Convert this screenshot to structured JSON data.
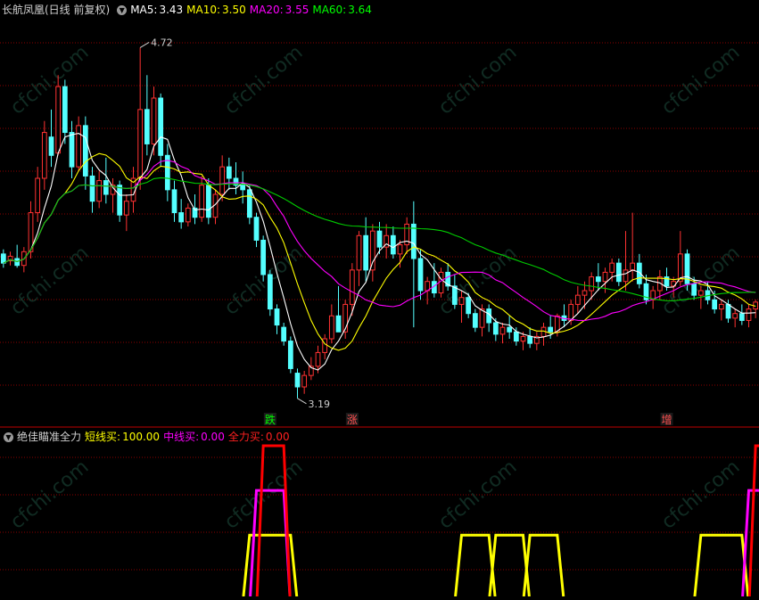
{
  "main": {
    "title": "长航凤凰(日线 前复权)",
    "ma5_label": "MA5:",
    "ma5_value": "3.43",
    "ma10_label": "MA10:",
    "ma10_value": "3.50",
    "ma20_label": "MA20:",
    "ma20_value": "3.55",
    "ma60_label": "MA60:",
    "ma60_value": "3.64",
    "high_mark": "4.72",
    "low_mark": "3.19",
    "signals": [
      "跌",
      "涨",
      "增"
    ]
  },
  "indicator": {
    "title": "绝佳瞄准全力",
    "short_label": "短线买:",
    "short_value": "100.00",
    "mid_label": "中线买:",
    "mid_value": "0.00",
    "full_label": "全力买:",
    "full_value": "0.00"
  },
  "colors": {
    "background": "#000000",
    "grid": "#8b0000",
    "up_candle": "#ff3232",
    "down_candle": "#54ffff",
    "ma5": "#ffffff",
    "ma10": "#ffff00",
    "ma20": "#ff00ff",
    "ma60": "#00cc00",
    "short_buy": "#ffff00",
    "mid_buy": "#ff00ff",
    "full_buy": "#ff0000",
    "watermark": "#1e4f3e"
  },
  "icons": [
    "circle-dropdown-icon"
  ],
  "watermark": "cfchi.com",
  "chart_data": [
    {
      "type": "candlestick",
      "title": "长航凤凰(日线 前复权)",
      "ylim": [
        3.1,
        4.85
      ],
      "annotations": {
        "high": 4.72,
        "low": 3.19
      },
      "signals": [
        {
          "text": "跌",
          "index": 39
        },
        {
          "text": "涨",
          "index": 51
        },
        {
          "text": "增",
          "index": 97
        }
      ],
      "candles": [
        [
          3.82,
          3.84,
          3.76,
          3.78
        ],
        [
          3.79,
          3.83,
          3.77,
          3.81
        ],
        [
          3.8,
          3.86,
          3.76,
          3.77
        ],
        [
          3.77,
          3.85,
          3.74,
          3.83
        ],
        [
          3.83,
          4.05,
          3.8,
          4.0
        ],
        [
          4.0,
          4.2,
          3.96,
          4.15
        ],
        [
          4.15,
          4.4,
          4.1,
          4.35
        ],
        [
          4.33,
          4.45,
          4.2,
          4.25
        ],
        [
          4.26,
          4.6,
          4.25,
          4.55
        ],
        [
          4.55,
          4.58,
          4.3,
          4.35
        ],
        [
          4.35,
          4.4,
          4.15,
          4.2
        ],
        [
          4.2,
          4.42,
          4.18,
          4.38
        ],
        [
          4.38,
          4.42,
          4.1,
          4.16
        ],
        [
          4.16,
          4.2,
          4.0,
          4.05
        ],
        [
          4.05,
          4.18,
          4.02,
          4.14
        ],
        [
          4.14,
          4.24,
          4.04,
          4.08
        ],
        [
          4.08,
          4.15,
          4.0,
          4.12
        ],
        [
          4.12,
          4.14,
          3.96,
          3.99
        ],
        [
          3.99,
          4.08,
          3.92,
          4.05
        ],
        [
          4.05,
          4.2,
          4.0,
          4.15
        ],
        [
          4.15,
          4.72,
          4.1,
          4.45
        ],
        [
          4.45,
          4.6,
          4.25,
          4.3
        ],
        [
          4.3,
          4.55,
          4.25,
          4.5
        ],
        [
          4.5,
          4.52,
          4.2,
          4.25
        ],
        [
          4.25,
          4.3,
          4.05,
          4.1
        ],
        [
          4.1,
          4.14,
          3.96,
          4.0
        ],
        [
          4.0,
          4.06,
          3.93,
          3.96
        ],
        [
          3.96,
          4.04,
          3.94,
          4.02
        ],
        [
          4.02,
          4.08,
          3.95,
          3.98
        ],
        [
          3.98,
          4.16,
          3.96,
          4.12
        ],
        [
          4.12,
          4.15,
          3.95,
          3.98
        ],
        [
          3.98,
          4.1,
          3.95,
          4.08
        ],
        [
          4.08,
          4.25,
          4.05,
          4.2
        ],
        [
          4.2,
          4.24,
          4.1,
          4.15
        ],
        [
          4.15,
          4.22,
          4.08,
          4.12
        ],
        [
          4.12,
          4.18,
          4.04,
          4.1
        ],
        [
          4.1,
          4.12,
          3.95,
          3.98
        ],
        [
          3.98,
          4.0,
          3.85,
          3.88
        ],
        [
          3.88,
          3.9,
          3.7,
          3.73
        ],
        [
          3.73,
          3.75,
          3.55,
          3.58
        ],
        [
          3.58,
          3.6,
          3.47,
          3.51
        ],
        [
          3.5,
          3.52,
          3.42,
          3.44
        ],
        [
          3.44,
          3.46,
          3.3,
          3.32
        ],
        [
          3.3,
          3.32,
          3.19,
          3.24
        ],
        [
          3.24,
          3.31,
          3.21,
          3.29
        ],
        [
          3.29,
          3.37,
          3.27,
          3.33
        ],
        [
          3.33,
          3.42,
          3.3,
          3.39
        ],
        [
          3.39,
          3.47,
          3.36,
          3.45
        ],
        [
          3.45,
          3.6,
          3.43,
          3.55
        ],
        [
          3.55,
          3.68,
          3.5,
          3.48
        ],
        [
          3.48,
          3.62,
          3.45,
          3.6
        ],
        [
          3.6,
          3.78,
          3.55,
          3.75
        ],
        [
          3.75,
          3.92,
          3.68,
          3.9
        ],
        [
          3.9,
          3.98,
          3.7,
          3.75
        ],
        [
          3.75,
          3.95,
          3.7,
          3.92
        ],
        [
          3.92,
          3.96,
          3.82,
          3.85
        ],
        [
          3.85,
          3.95,
          3.8,
          3.9
        ],
        [
          3.9,
          3.94,
          3.8,
          3.82
        ],
        [
          3.82,
          3.88,
          3.76,
          3.86
        ],
        [
          3.86,
          3.98,
          3.82,
          3.95
        ],
        [
          3.95,
          4.05,
          3.5,
          3.8
        ],
        [
          3.8,
          3.84,
          3.62,
          3.66
        ],
        [
          3.66,
          3.72,
          3.6,
          3.7
        ],
        [
          3.7,
          3.78,
          3.63,
          3.65
        ],
        [
          3.65,
          3.76,
          3.63,
          3.74
        ],
        [
          3.74,
          3.78,
          3.66,
          3.68
        ],
        [
          3.68,
          3.73,
          3.58,
          3.6
        ],
        [
          3.6,
          3.66,
          3.52,
          3.63
        ],
        [
          3.63,
          3.65,
          3.54,
          3.56
        ],
        [
          3.56,
          3.58,
          3.48,
          3.5
        ],
        [
          3.5,
          3.6,
          3.46,
          3.58
        ],
        [
          3.58,
          3.6,
          3.48,
          3.52
        ],
        [
          3.52,
          3.54,
          3.44,
          3.47
        ],
        [
          3.47,
          3.52,
          3.43,
          3.5
        ],
        [
          3.5,
          3.55,
          3.45,
          3.48
        ],
        [
          3.48,
          3.5,
          3.42,
          3.44
        ],
        [
          3.44,
          3.48,
          3.4,
          3.46
        ],
        [
          3.46,
          3.5,
          3.41,
          3.43
        ],
        [
          3.43,
          3.48,
          3.4,
          3.46
        ],
        [
          3.46,
          3.52,
          3.42,
          3.5
        ],
        [
          3.5,
          3.55,
          3.45,
          3.48
        ],
        [
          3.48,
          3.56,
          3.46,
          3.55
        ],
        [
          3.55,
          3.6,
          3.5,
          3.53
        ],
        [
          3.53,
          3.62,
          3.51,
          3.6
        ],
        [
          3.6,
          3.68,
          3.56,
          3.64
        ],
        [
          3.64,
          3.7,
          3.58,
          3.66
        ],
        [
          3.66,
          3.74,
          3.62,
          3.72
        ],
        [
          3.72,
          3.78,
          3.66,
          3.7
        ],
        [
          3.7,
          3.76,
          3.65,
          3.74
        ],
        [
          3.74,
          3.8,
          3.7,
          3.78
        ],
        [
          3.78,
          3.8,
          3.68,
          3.7
        ],
        [
          3.7,
          3.92,
          3.66,
          3.75
        ],
        [
          3.75,
          4.0,
          3.7,
          3.78
        ],
        [
          3.78,
          3.82,
          3.67,
          3.69
        ],
        [
          3.69,
          3.73,
          3.6,
          3.62
        ],
        [
          3.62,
          3.68,
          3.58,
          3.66
        ],
        [
          3.66,
          3.75,
          3.62,
          3.72
        ],
        [
          3.72,
          3.76,
          3.66,
          3.68
        ],
        [
          3.68,
          3.72,
          3.63,
          3.7
        ],
        [
          3.7,
          3.92,
          3.68,
          3.82
        ],
        [
          3.82,
          3.84,
          3.66,
          3.69
        ],
        [
          3.69,
          3.72,
          3.62,
          3.64
        ],
        [
          3.64,
          3.68,
          3.58,
          3.66
        ],
        [
          3.66,
          3.7,
          3.6,
          3.62
        ],
        [
          3.62,
          3.66,
          3.56,
          3.58
        ],
        [
          3.58,
          3.62,
          3.53,
          3.6
        ],
        [
          3.6,
          3.62,
          3.52,
          3.54
        ],
        [
          3.54,
          3.58,
          3.5,
          3.56
        ],
        [
          3.56,
          3.6,
          3.51,
          3.53
        ],
        [
          3.53,
          3.6,
          3.5,
          3.58
        ],
        [
          3.58,
          3.62,
          3.54,
          3.61
        ]
      ]
    },
    {
      "type": "step",
      "title": "绝佳瞄准全力",
      "ylim": [
        0,
        100
      ],
      "series": [
        {
          "name": "短线买",
          "values": [
            [
              36,
              42,
              40
            ],
            [
              67,
              71,
              40
            ],
            [
              72,
              76,
              40
            ],
            [
              77,
              81,
              40
            ],
            [
              102,
              108,
              40
            ]
          ]
        },
        {
          "name": "中线买",
          "values": [
            [
              37,
              41,
              70
            ],
            [
              109,
              114,
              70
            ]
          ]
        },
        {
          "name": "全力买",
          "values": [
            [
              38,
              41,
              100
            ],
            [
              110,
              113,
              100
            ]
          ]
        }
      ]
    }
  ]
}
